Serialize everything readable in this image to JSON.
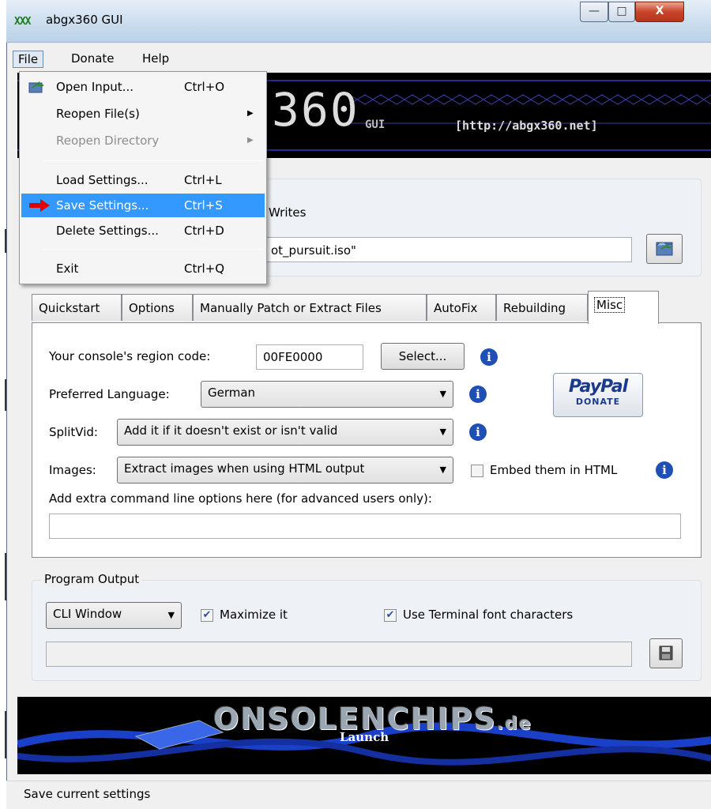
{
  "window": {
    "title": "abgx360 GUI",
    "caption_minimize": "—",
    "caption_maximize": "□",
    "caption_close": "X",
    "title_logo": "XXX"
  },
  "menubar": {
    "file": "File",
    "donate": "Donate",
    "help": "Help"
  },
  "file_menu": {
    "items": [
      {
        "label": "Open Input...",
        "shortcut": "Ctrl+O"
      },
      {
        "label": "Reopen File(s)",
        "shortcut": ""
      },
      {
        "label": "Reopen Directory",
        "shortcut": ""
      },
      {
        "label": "Load Settings...",
        "shortcut": "Ctrl+L"
      },
      {
        "label": "Save Settings...",
        "shortcut": "Ctrl+S"
      },
      {
        "label": "Delete Settings...",
        "shortcut": "Ctrl+D"
      },
      {
        "label": "Exit",
        "shortcut": "Ctrl+Q"
      }
    ]
  },
  "banner": {
    "big": "360",
    "gui": "GUI",
    "url": "[http://abgx360.net]"
  },
  "input": {
    "writes_label": "Writes",
    "file_value": "ot_pursuit.iso\""
  },
  "tabs": [
    "Quickstart",
    "Options",
    "Manually Patch or Extract Files",
    "AutoFix",
    "Rebuilding",
    "Misc"
  ],
  "misc": {
    "region_label": "Your console's region code:",
    "region_value": "00FE0000",
    "select_button": "Select...",
    "language_label": "Preferred Language:",
    "language_value": "German",
    "splitvid_label": "SplitVid:",
    "splitvid_value": "Add it if it doesn't exist or isn't valid",
    "images_label": "Images:",
    "images_value": "Extract images when using HTML output",
    "embed_label": "Embed them in HTML",
    "embed_checked": false,
    "extra_label": "Add extra command line options here (for advanced users only):",
    "extra_value": "",
    "paypal_brand": "PayPal",
    "paypal_donate": "DONATE"
  },
  "program_output": {
    "title": "Program Output",
    "mode": "CLI Window",
    "maximize_label": "Maximize it",
    "maximize_checked": true,
    "terminal_label": "Use Terminal font characters",
    "terminal_checked": true,
    "path_value": ""
  },
  "footer": {
    "brand": "ONSOLENCHIPS",
    "brand_suffix": ".de",
    "launch": "Launch"
  },
  "status": {
    "text": "Save current settings"
  },
  "colors": {
    "highlight": "#3399ff",
    "banner_bg": "#000000",
    "info_icon": "#1e4fb4",
    "arrow": "#e00000"
  }
}
